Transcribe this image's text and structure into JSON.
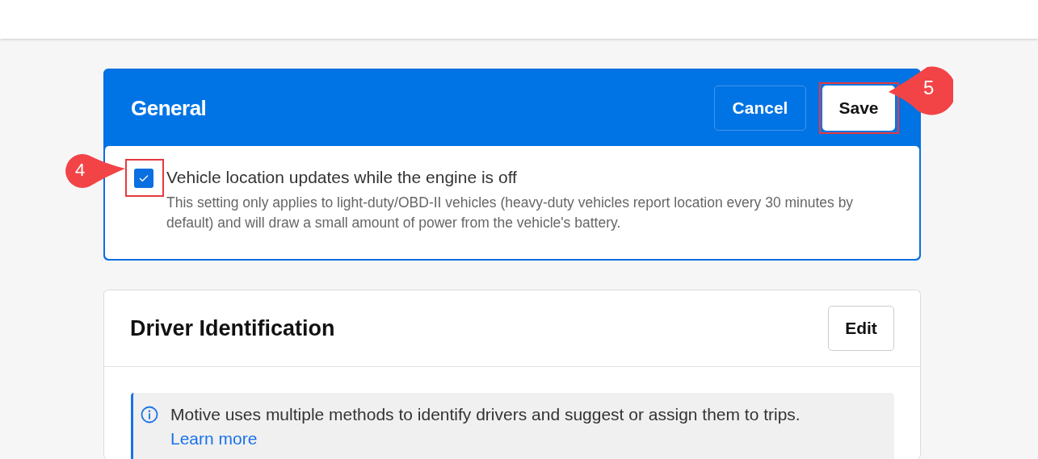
{
  "general": {
    "title": "General",
    "buttons": [
      {
        "label": "Cancel",
        "kind": "secondary"
      },
      {
        "label": "Save",
        "kind": "primary",
        "callout": "5"
      }
    ],
    "setting": {
      "label": "Vehicle location updates while the engine is off",
      "checked": true,
      "callout": "4",
      "description": "This setting only applies to light-duty/OBD-II vehicles (heavy-duty vehicles report location every 30 minutes by default) and will draw a small amount of power from the vehicle's battery."
    }
  },
  "driver_identification": {
    "title": "Driver Identification",
    "edit_button": "Edit",
    "info": {
      "text": "Motive uses multiple methods to identify drivers and suggest or assign them to trips.",
      "link": "Learn more"
    }
  }
}
